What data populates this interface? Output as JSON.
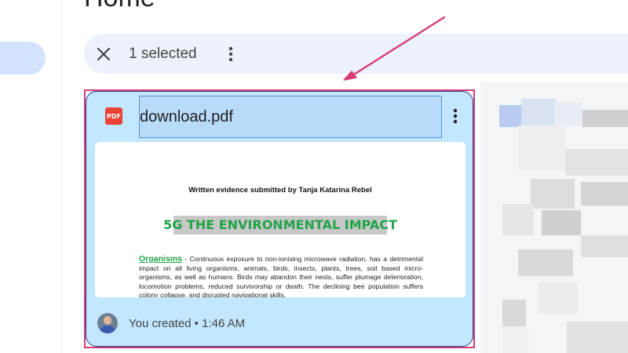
{
  "page": {
    "title": "Home"
  },
  "selection_bar": {
    "count_label": "1 selected",
    "close_icon": "close-icon",
    "more_icon": "more-vert-icon"
  },
  "file_card": {
    "file_type_icon": "pdf-icon",
    "file_type_label": "PDF",
    "file_name": "download.pdf",
    "more_icon": "more-vert-icon",
    "preview": {
      "heading": "Written evidence submitted by Tanja Katarina Rebel",
      "title": "5G THE ENVIRONMENTAL IMPACT",
      "keyword": "Organisms",
      "body": " - Continuous exposure to non-ionising microwave radiation, has a detrimental impact on all living organisms, animals, birds, insects, plants, trees, soil based micro-organisms, as well as humans. Birds may abandon their nests, suffer plumage deterioration, locomotion problems, reduced survivorship or death. The declining bee population suffers colony collapse, and disrupted navigational skills."
    },
    "owner": {
      "avatar_icon": "avatar-icon",
      "label": "You created • 1:46 AM"
    }
  },
  "colors": {
    "accent_annotation": "#d63d78",
    "card_background": "#c2e7ff",
    "selection_bar": "#edf2fa",
    "pdf_red": "#ea4335"
  }
}
